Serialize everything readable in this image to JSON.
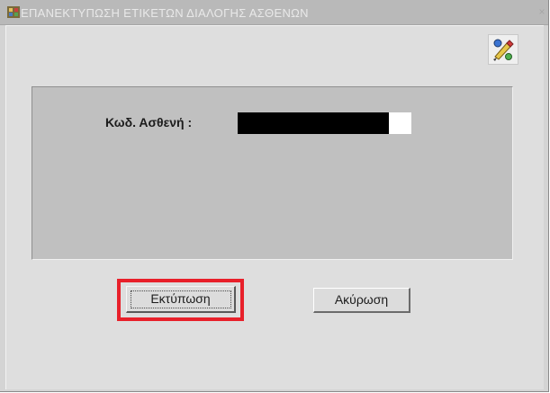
{
  "window": {
    "title": "ΕΠΑΝΕΚΤΥΠΩΣΗ ΕΤΙΚΕΤΩΝ ΔΙΑΛΟΓΗΣ ΑΣΘΕΝΩΝ",
    "close_glyph": "×",
    "app_icon": "app-window-icon"
  },
  "toolbar": {
    "help_icon": "help-paint-icon"
  },
  "form": {
    "patient_code_label": "Κωδ. Ασθενή :",
    "patient_code_value": ""
  },
  "buttons": {
    "print_label": "Εκτύπωση",
    "cancel_label": "Ακύρωση"
  },
  "colors": {
    "highlight": "#e8202a",
    "input_fill": "#000000",
    "panel": "#c0c0c0"
  }
}
